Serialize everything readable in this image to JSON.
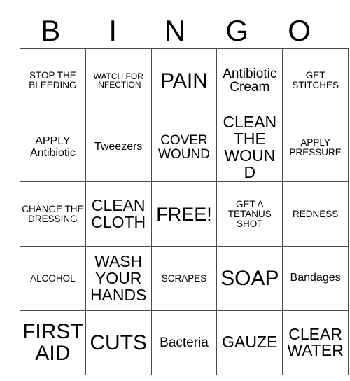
{
  "card": {
    "header_letters": [
      "B",
      "I",
      "N",
      "G",
      "O"
    ],
    "rows": [
      [
        {
          "text": "STOP THE BLEEDING",
          "size": "xs"
        },
        {
          "text": "WATCH FOR INFECTION",
          "size": "xxs"
        },
        {
          "text": "PAIN",
          "size": "xxl"
        },
        {
          "text": "Antibiotic Cream",
          "size": "md"
        },
        {
          "text": "GET STITCHES",
          "size": "xs"
        }
      ],
      [
        {
          "text": "APPLY Antibiotic",
          "size": "sm"
        },
        {
          "text": "Tweezers",
          "size": "sm"
        },
        {
          "text": "COVER WOUND",
          "size": "md"
        },
        {
          "text": "CLEAN THE WOUND",
          "size": "lg"
        },
        {
          "text": "APPLY PRESSURE",
          "size": "xs"
        }
      ],
      [
        {
          "text": "CHANGE THE DRESSING",
          "size": "xs"
        },
        {
          "text": "CLEAN CLOTH",
          "size": "lg"
        },
        {
          "text": "FREE!",
          "size": "xl"
        },
        {
          "text": "GET A TETANUS SHOT",
          "size": "xs"
        },
        {
          "text": "REDNESS",
          "size": "xs"
        }
      ],
      [
        {
          "text": "ALCOHOL",
          "size": "xs"
        },
        {
          "text": "WASH YOUR HANDS",
          "size": "lg"
        },
        {
          "text": "SCRAPES",
          "size": "xs"
        },
        {
          "text": "SOAP",
          "size": "xxl"
        },
        {
          "text": "Bandages",
          "size": "sm"
        }
      ],
      [
        {
          "text": "FIRST AID",
          "size": "xxl"
        },
        {
          "text": "CUTS",
          "size": "xxl"
        },
        {
          "text": "Bacteria",
          "size": "md"
        },
        {
          "text": "GAUZE",
          "size": "lg"
        },
        {
          "text": "CLEAR WATER",
          "size": "lg"
        }
      ]
    ]
  }
}
